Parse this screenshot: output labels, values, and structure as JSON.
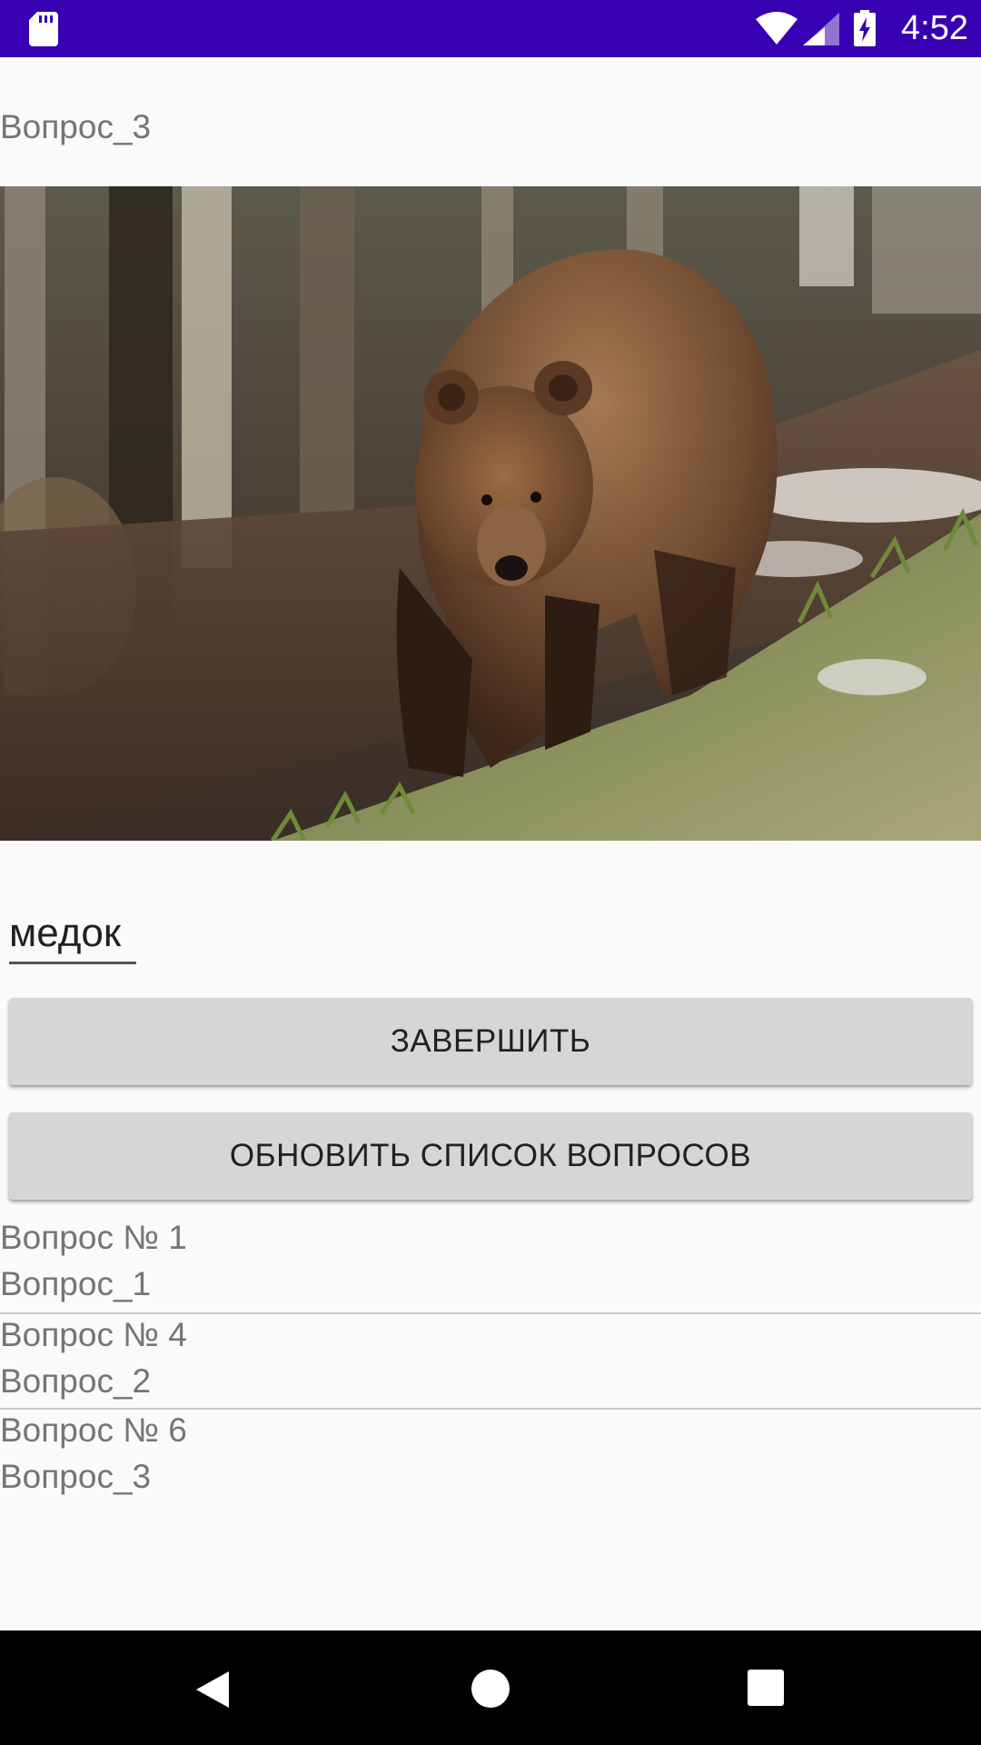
{
  "status_bar": {
    "time": "4:52",
    "background_color": "#3700b3",
    "icons": [
      "sd-card-icon",
      "wifi-icon",
      "cell-signal-icon",
      "battery-charging-icon"
    ]
  },
  "question": {
    "title": "Вопрос_3",
    "image": "brown-bear-photo"
  },
  "answer": {
    "value": "медок"
  },
  "buttons": {
    "finish_label": "ЗАВЕРШИТЬ",
    "refresh_label": "ОБНОВИТЬ СПИСОК ВОПРОСОВ"
  },
  "questions_list": [
    {
      "number": "Вопрос № 1",
      "name": "Вопрос_1"
    },
    {
      "number": "Вопрос № 4",
      "name": "Вопрос_2"
    },
    {
      "number": "Вопрос № 6",
      "name": "Вопрос_3"
    }
  ],
  "nav_bar": {
    "icons": [
      "back-icon",
      "home-icon",
      "recents-icon"
    ]
  }
}
